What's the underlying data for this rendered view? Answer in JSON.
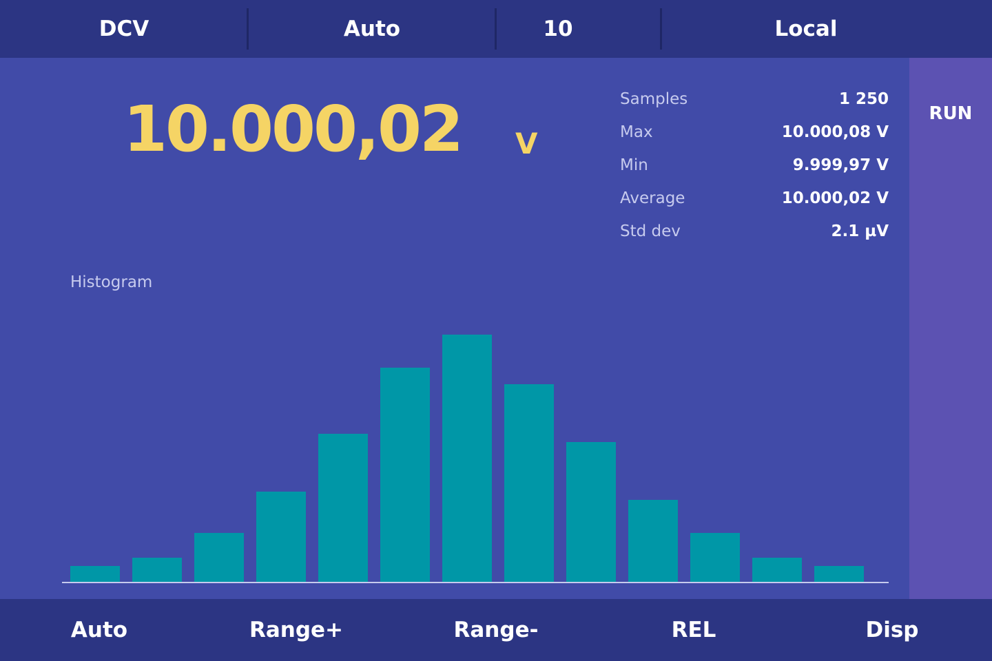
{
  "status_bar": {
    "function": "DCV",
    "range": "Auto",
    "nplc": "10",
    "remote_state": "Local"
  },
  "reading": {
    "value": "10.000,02",
    "unit": "V"
  },
  "stats": [
    {
      "label": "Samples",
      "value": "1 250"
    },
    {
      "label": "Max",
      "value": "10.000,08 V"
    },
    {
      "label": "Min",
      "value": "9.999,97 V"
    },
    {
      "label": "Average",
      "value": "10.000,02 V"
    },
    {
      "label": "Std dev",
      "value": "2.1 µV"
    }
  ],
  "histogram": {
    "title": "Histogram"
  },
  "chart_data": {
    "type": "bar",
    "title": "Histogram",
    "values": [
      2,
      3,
      6,
      11,
      18,
      26,
      30,
      24,
      17,
      10,
      6,
      3,
      2
    ],
    "ylim": [
      0,
      30
    ],
    "grid": false,
    "color": "#0097a7"
  },
  "run_state": "RUN",
  "softkeys": [
    "Auto",
    "Range+",
    "Range-",
    "REL",
    "Disp"
  ],
  "colors": {
    "background": "#414ba8",
    "bars_bg": "#2c3583",
    "reading": "#f5d465",
    "side_panel": "#5c52b2",
    "histogram_bar": "#0097a7"
  }
}
